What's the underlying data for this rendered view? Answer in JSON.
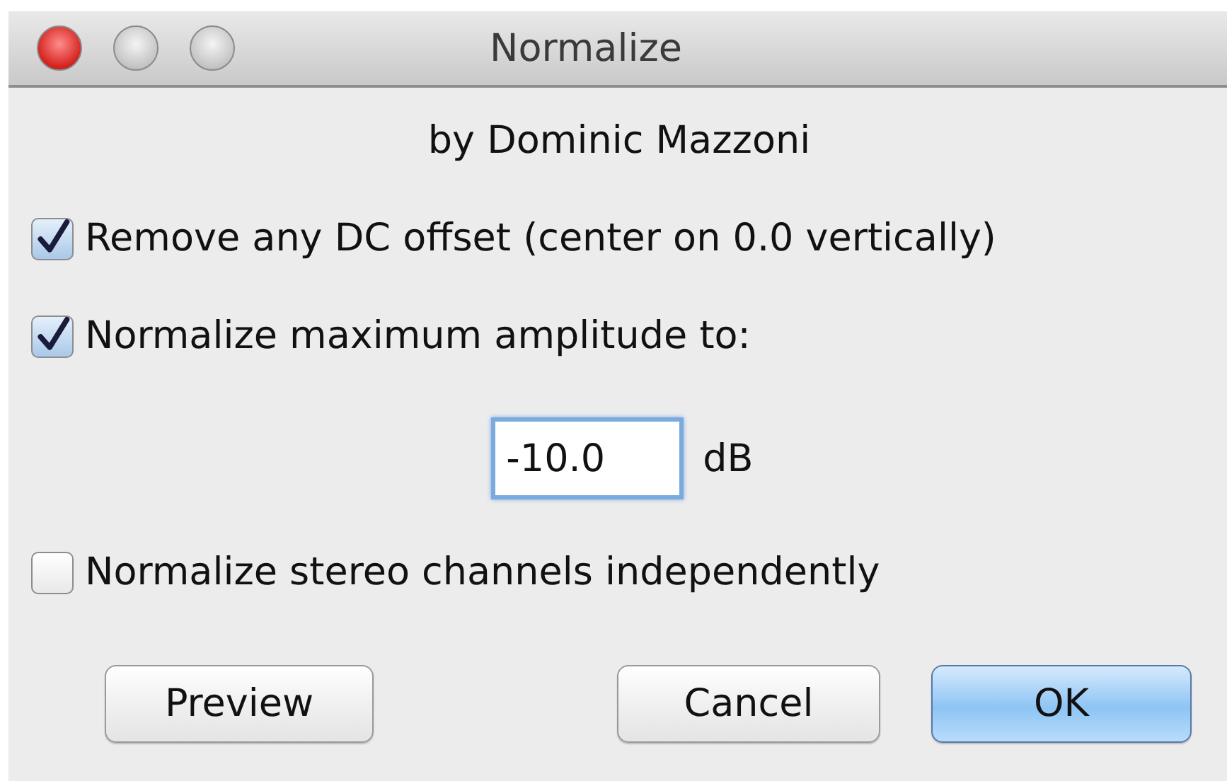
{
  "window": {
    "title": "Normalize"
  },
  "subtitle": "by Dominic Mazzoni",
  "options": [
    {
      "label": "Remove any DC offset (center on 0.0 vertically)",
      "checked": true
    },
    {
      "label": "Normalize maximum amplitude to:",
      "checked": true
    }
  ],
  "amplitude": {
    "value": "-10.0",
    "unit": "dB"
  },
  "stereo_option": {
    "label": "Normalize stereo channels independently",
    "checked": false
  },
  "buttons": [
    {
      "label": "Preview",
      "default": false
    },
    {
      "label": "Cancel",
      "default": false
    },
    {
      "label": "OK",
      "default": true
    }
  ]
}
